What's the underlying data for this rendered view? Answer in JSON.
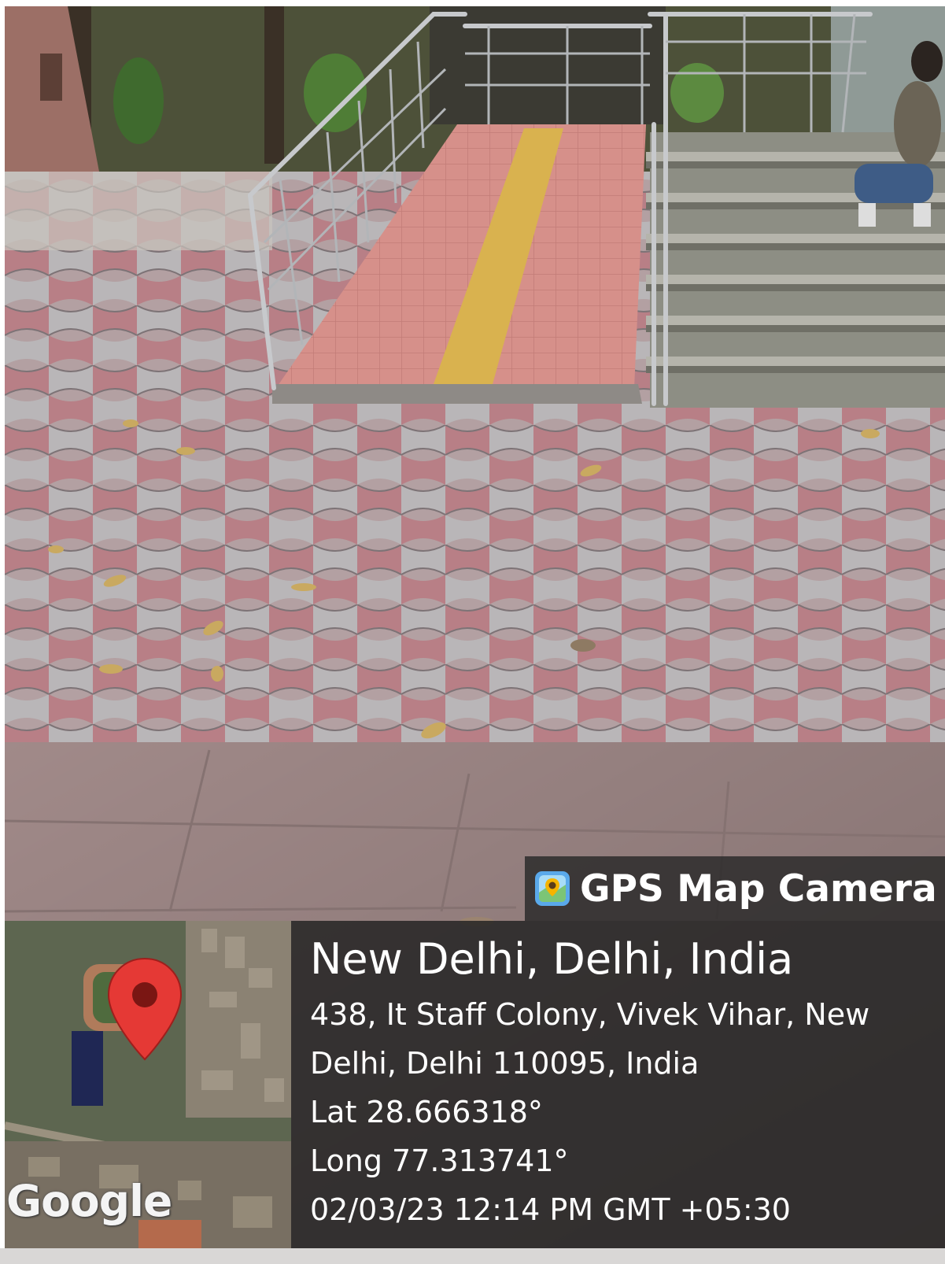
{
  "photo": {
    "subject": "paved-courtyard-with-ramp-and-steps"
  },
  "overlay": {
    "app_name": "GPS Map Camera",
    "app_icon": "gps-map-camera-icon",
    "map_brand": "Google",
    "map_pin_icon": "map-pin-icon",
    "location_title": "New Delhi, Delhi, India",
    "address_line_1": "438, It Staff Colony, Vivek Vihar, New",
    "address_line_2": "Delhi, Delhi 110095, India",
    "latitude": "Lat 28.666318°",
    "longitude": "Long 77.313741°",
    "timestamp": "02/03/23 12:14 PM GMT +05:30",
    "pin_color": "#e53935"
  }
}
